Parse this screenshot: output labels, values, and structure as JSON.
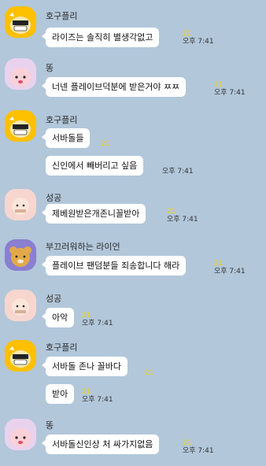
{
  "messages": [
    {
      "sender": "호구플리",
      "text": "라이즈는 솔직히 별생각없고",
      "read": "21",
      "time": "오후 7:41"
    },
    {
      "sender": "똥",
      "text": "너넨 플레이브덕분에 받은거야 ㅉㅉ",
      "read": "21",
      "time": "오후 7:41"
    },
    {
      "sender": "호구플리",
      "text": "서바돌들",
      "read": "21",
      "time": ""
    },
    {
      "sender": "",
      "text": "신인에서 빼버리고 싶음",
      "read": "",
      "time": "오후 7:41"
    },
    {
      "sender": "성공",
      "text": "제베원받은개존니꼴받아",
      "read": "21",
      "time": "오후 7:41"
    },
    {
      "sender": "부끄러워하는 라이언",
      "text": "플레이브 팬덤분들 죄송합니다 해라",
      "read": "21",
      "time": "오후 7:41"
    },
    {
      "sender": "성공",
      "text": "아악",
      "read": "21",
      "time": "오후 7:41"
    },
    {
      "sender": "호구플리",
      "text": "서바돌 존나 꼴바다",
      "read": "21",
      "time": ""
    },
    {
      "sender": "",
      "text": "받아",
      "read": "21",
      "time": "오후 7:41"
    },
    {
      "sender": "똥",
      "text": "서바돌신인상 처 싸가지없음",
      "read": "21",
      "time": "오후 7:41"
    }
  ],
  "avatars": {
    "muzi": {
      "icon": "muzi-character-icon",
      "bg": "#ffc000"
    },
    "peach": {
      "icon": "apeach-character-icon",
      "bg": "#e9d2ee"
    },
    "tube": {
      "icon": "tube-character-icon",
      "bg": "#f7d6d0"
    },
    "ryan": {
      "icon": "ryan-character-icon",
      "bg": "#8a7fd0"
    }
  }
}
